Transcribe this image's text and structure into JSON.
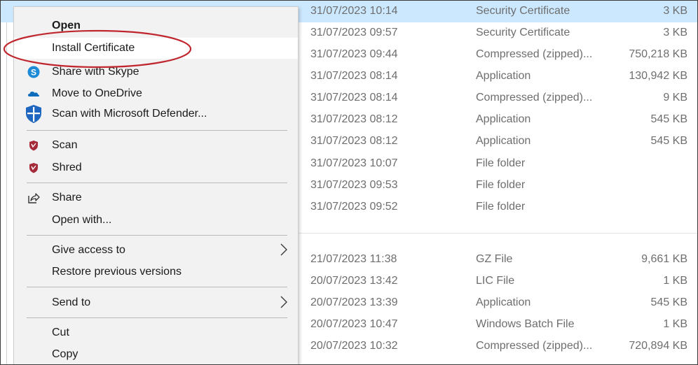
{
  "files": [
    {
      "date": "31/07/2023 10:14",
      "type": "Security Certificate",
      "size": "3 KB"
    },
    {
      "date": "31/07/2023 09:57",
      "type": "Security Certificate",
      "size": "3 KB"
    },
    {
      "date": "31/07/2023 09:44",
      "type": "Compressed (zipped)...",
      "size": "750,218 KB"
    },
    {
      "date": "31/07/2023 08:14",
      "type": "Application",
      "size": "130,942 KB"
    },
    {
      "date": "31/07/2023 08:14",
      "type": "Compressed (zipped)...",
      "size": "9 KB"
    },
    {
      "date": "31/07/2023 08:12",
      "type": "Application",
      "size": "545 KB"
    },
    {
      "date": "31/07/2023 08:12",
      "type": "Application",
      "size": "545 KB"
    },
    {
      "date": "31/07/2023 10:07",
      "type": "File folder",
      "size": ""
    },
    {
      "date": "31/07/2023 09:53",
      "type": "File folder",
      "size": ""
    },
    {
      "date": "31/07/2023 09:52",
      "type": "File folder",
      "size": ""
    },
    {
      "date": "21/07/2023 11:38",
      "type": "GZ File",
      "size": "9,661 KB"
    },
    {
      "date": "20/07/2023 13:42",
      "type": "LIC File",
      "size": "1 KB"
    },
    {
      "date": "20/07/2023 13:39",
      "type": "Application",
      "size": "545 KB"
    },
    {
      "date": "20/07/2023 10:47",
      "type": "Windows Batch File",
      "size": "1 KB"
    },
    {
      "date": "20/07/2023 10:32",
      "type": "Compressed (zipped)...",
      "size": "720,894 KB"
    }
  ],
  "context_menu": {
    "items": [
      {
        "label": "Open",
        "icon": ""
      },
      {
        "label": "Install Certificate",
        "icon": ""
      },
      {
        "label": "Share with Skype",
        "icon": "skype-icon"
      },
      {
        "label": "Move to OneDrive",
        "icon": "onedrive-cloud-icon"
      },
      {
        "label": "Scan with Microsoft Defender...",
        "icon": "defender-shield-icon"
      },
      {
        "label": "Scan",
        "icon": "antivirus-shield-icon"
      },
      {
        "label": "Shred",
        "icon": "antivirus-shield-icon"
      },
      {
        "label": "Share",
        "icon": "share-icon"
      },
      {
        "label": "Open with...",
        "icon": ""
      },
      {
        "label": "Give access to",
        "icon": "",
        "submenu": true
      },
      {
        "label": "Restore previous versions",
        "icon": ""
      },
      {
        "label": "Send to",
        "icon": "",
        "submenu": true
      },
      {
        "label": "Cut",
        "icon": ""
      },
      {
        "label": "Copy",
        "icon": ""
      }
    ]
  },
  "colors": {
    "selection": "#cce8ff",
    "menu_background": "#f2f2f2",
    "highlight_ring": "#c0262d",
    "skype": "#1c8ad6",
    "onedrive": "#0f6cbd",
    "defender": "#1f66c1",
    "antivirus": "#a52a3a"
  }
}
